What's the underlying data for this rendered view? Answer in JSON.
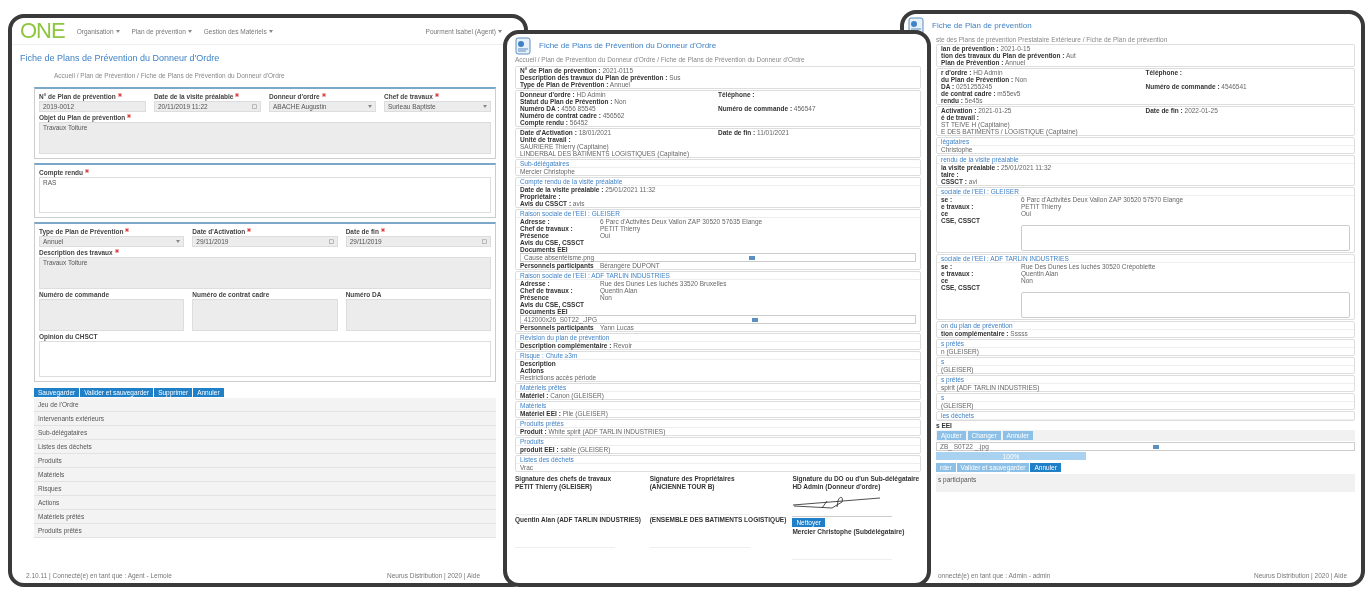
{
  "left_window": {
    "logo": "ONE",
    "nav": [
      {
        "label": "Organisation"
      },
      {
        "label": "Plan de prévention"
      },
      {
        "label": "Gestion des Matériels"
      }
    ],
    "user": "Pourment Isabel (Agent)",
    "title": "Fiche de Plans de Prévention du Donneur d'Ordre",
    "breadcrumb": "Accueil / Plan de Prévention / Fiche de Plans de Prévention du Donneur d'Ordre",
    "panels": [
      {
        "fields": [
          {
            "label": "N° de Plan de prévention",
            "required": true,
            "kind": "input",
            "value": "2019-0012"
          },
          {
            "label": "Date de la visite préalable",
            "required": true,
            "kind": "date",
            "value": "20/11/2019 11:22"
          },
          {
            "label": "Donneur d'ordre",
            "required": true,
            "kind": "select",
            "value": "ABACHE Augustin"
          },
          {
            "label": "Chef de travaux",
            "required": true,
            "kind": "select",
            "value": "Surleau Baptiste"
          },
          {
            "label": "Objet du Plan de prévention",
            "required": true,
            "kind": "textarea",
            "value": "Travaux Toiture",
            "wide": true
          }
        ]
      },
      {
        "fields": [
          {
            "label": "Compte rendu",
            "required": true,
            "kind": "note",
            "value": "RAS"
          }
        ]
      },
      {
        "fields": [
          {
            "label": "Type de Plan de Prévention",
            "required": true,
            "kind": "select",
            "value": "Annuel"
          },
          {
            "label": "Date d'Activation",
            "required": true,
            "kind": "date",
            "value": "29/11/2019"
          },
          {
            "label": "Date de fin",
            "required": true,
            "kind": "date",
            "value": "29/11/2019"
          },
          {
            "label": "Description des travaux",
            "required": true,
            "kind": "textarea",
            "value": "Travaux Toiture",
            "wide": true
          },
          {
            "label": "Numéro de commande",
            "required": false,
            "kind": "textarea"
          },
          {
            "label": "Numéro de contrat cadre",
            "required": false,
            "kind": "textarea"
          },
          {
            "label": "Numéro DA",
            "required": false,
            "kind": "textarea"
          },
          {
            "label": "Opinion du CHSCT",
            "required": false,
            "kind": "note",
            "wide": true
          }
        ]
      }
    ],
    "buttons": [
      "Sauvegarder",
      "Valider et sauvegarder",
      "Supprimer",
      "Annuler"
    ],
    "sections": [
      "Jeu de l'Ordre",
      "Intervenants extérieurs",
      "Sub-délégataires",
      "Listes des déchets",
      "Produits",
      "Matériels",
      "Risques",
      "Actions",
      "Matériels prêtés",
      "Produits prêtés"
    ],
    "footer_left": "2.10.11 | Connecté(e) en tant que : Agent - Lemoie",
    "footer_right": "Neurus Distribution | 2020 | Aide"
  },
  "middle_window": {
    "title": "Fiche de Plans de Prévention du Donneur d'Ordre",
    "breadcrumb": "Accueil / Plan de Prévention du Donneur d'Ordre / Fiche de Plans de Prévention du Donneur d'Ordre",
    "cards": [
      {
        "kind": "inline",
        "rows": [
          [
            {
              "kind": "pair",
              "label": "N° de Plan de prévention :",
              "value": "2021-0115"
            }
          ],
          [
            {
              "kind": "pair",
              "label": "Description des travaux du Plan de prévention :",
              "value": "Sus"
            }
          ],
          [
            {
              "kind": "pair",
              "label": "Type de Plan de Prévention :",
              "value": "Annuel"
            }
          ]
        ]
      },
      {
        "kind": "inline",
        "rows": [
          [
            {
              "kind": "pair",
              "label": "Donneur d'ordre :",
              "value": "HD Admin"
            },
            {
              "kind": "pair",
              "label": "Téléphone :"
            }
          ],
          [
            {
              "kind": "pair",
              "label": "Statut du Plan de Prévention :",
              "value": "Non"
            }
          ],
          [
            {
              "kind": "pair",
              "label": "Numéro DA :",
              "value": "4556 85545"
            },
            {
              "kind": "pair",
              "label": "Numéro de commande :",
              "value": "456547"
            }
          ],
          [
            {
              "kind": "pair",
              "label": "Numéro de contrat cadre :",
              "value": "456562"
            }
          ],
          [
            {
              "kind": "pair",
              "label": "Compte rendu :",
              "value": "56452"
            }
          ]
        ]
      },
      {
        "kind": "inline",
        "rows": [
          [
            {
              "kind": "pair",
              "label": "Date d'Activation :",
              "value": "18/01/2021"
            },
            {
              "kind": "pair",
              "label": "Date de fin :",
              "value": "11/01/2021"
            }
          ],
          [
            {
              "kind": "pair",
              "label": "Unité de travail :"
            }
          ],
          [
            {
              "kind": "text",
              "text": "SAURIERE Thierry (Capitaine)"
            }
          ],
          [
            {
              "kind": "text",
              "text": "LINDERBAL DES BATIMENTS LOGISTIQUES (Capitaine)"
            }
          ]
        ]
      },
      {
        "heading": "Sub-délégataires",
        "kind": "inline",
        "rows": [
          [
            {
              "kind": "text",
              "text": "Mercier Christophe"
            }
          ]
        ]
      },
      {
        "heading": "Compte rendu de la visite préalable",
        "kind": "inline",
        "rows": [
          [
            {
              "kind": "pair",
              "label": "Date de la visite préalable :",
              "value": "25/01/2021 11:32"
            }
          ],
          [
            {
              "kind": "pair",
              "label": "Propriétaire :"
            }
          ],
          [
            {
              "kind": "pair",
              "label": "Avis du CSSCT :",
              "value": "avis"
            }
          ]
        ]
      },
      {
        "heading": "Raison sociale de l'EEI : GLEISER",
        "kind": "table",
        "rows": [
          [
            {
              "kind": "pair",
              "label": "Adresse :",
              "value": "6 Parc d'Activités Deux Vallon ZAP 30520 57635 Elange"
            }
          ],
          [
            {
              "kind": "pair",
              "label": "Chef de travaux :",
              "value": "PETIT Thierry"
            }
          ],
          [
            {
              "kind": "pair",
              "label": "Présence",
              "value": "Oui"
            }
          ],
          [
            {
              "kind": "pair",
              "label": "Avis du CSE, CSSCT"
            }
          ],
          [
            {
              "kind": "pair",
              "label": "Documents EEI"
            }
          ],
          [
            {
              "kind": "file",
              "text": "Cause absentéisme.png"
            }
          ],
          [
            {
              "kind": "pair",
              "label": "Personnels participants",
              "value": "Bérangère DUPONT"
            }
          ]
        ]
      },
      {
        "heading": "Raison sociale de l'EEI : ADF TARLIN INDUSTRIES",
        "kind": "table",
        "rows": [
          [
            {
              "kind": "pair",
              "label": "Adresse :",
              "value": "Rue des Dunes Les Iuchés 33520 Bruxelles"
            }
          ],
          [
            {
              "kind": "pair",
              "label": "Chef de travaux :",
              "value": "Quentin Alan"
            }
          ],
          [
            {
              "kind": "pair",
              "label": "Présence",
              "value": "Non"
            }
          ],
          [
            {
              "kind": "pair",
              "label": "Avis du CSE, CSSCT"
            }
          ],
          [
            {
              "kind": "pair",
              "label": "Documents EEI"
            }
          ],
          [
            {
              "kind": "file",
              "text": "412000x26_S0T22_.JPG"
            }
          ],
          [
            {
              "kind": "pair",
              "label": "Personnels participants",
              "value": "Yann Lucas"
            }
          ]
        ]
      },
      {
        "heading": "Révision du plan de prévention",
        "kind": "inline",
        "rows": [
          [
            {
              "kind": "pair",
              "label": "Description complémentaire :",
              "value": "Revoir"
            }
          ]
        ]
      },
      {
        "heading": "Risque : Chute ≥3m",
        "kind": "inline",
        "rows": [
          [
            {
              "kind": "pair",
              "label": "Description"
            }
          ],
          [
            {
              "kind": "pair",
              "label": "Actions"
            }
          ],
          [
            {
              "kind": "text",
              "text": "Restrictions accès période"
            }
          ]
        ]
      },
      {
        "heading": "Matériels prêtés",
        "kind": "inline",
        "rows": [
          [
            {
              "kind": "pair",
              "label": "Matériel :",
              "value": "Canon (GLEISER)"
            }
          ]
        ]
      },
      {
        "heading": "Matériels",
        "kind": "inline",
        "rows": [
          [
            {
              "kind": "pair",
              "label": "Matériel EEI :",
              "value": "Pile (GLEISER)"
            }
          ]
        ]
      },
      {
        "heading": "Produits prêtés",
        "kind": "inline",
        "rows": [
          [
            {
              "kind": "pair",
              "label": "Produit :",
              "value": "White spirit (ADF TARLIN INDUSTRIES)"
            }
          ]
        ]
      },
      {
        "heading": "Produits",
        "kind": "inline",
        "rows": [
          [
            {
              "kind": "pair",
              "label": "produit EEI :",
              "value": "sable (GLEISER)"
            }
          ]
        ]
      },
      {
        "heading": "Listes des déchets",
        "kind": "inline",
        "rows": [
          [
            {
              "kind": "text",
              "text": "Vrac"
            }
          ]
        ]
      }
    ],
    "signatures": [
      {
        "heading": "Signature des chefs de travaux",
        "people": [
          {
            "name": "PETIT Thierry (GLEISER)",
            "signed": false
          },
          {
            "name": "Quentin Alan (ADF TARLIN INDUSTRIES)",
            "signed": false
          }
        ]
      },
      {
        "heading": "Signature des Propriétaires",
        "people": [
          {
            "name": "(ANCIENNE TOUR B)",
            "signed": false
          },
          {
            "name": "(ENSEMBLE DES BATIMENTS LOGISTIQUE)",
            "signed": false
          }
        ]
      },
      {
        "heading": "Signature du DO ou d'un Sub-délégataire",
        "people": [
          {
            "name": "HD Admin (Donneur d'ordre)",
            "signed": true,
            "button": "Nettoyer"
          },
          {
            "name": "Mercier Christophe (Subdélégataire)",
            "signed": false
          }
        ]
      }
    ]
  },
  "right_window": {
    "title": "Fiche de Plan de prévention",
    "breadcrumb": "ste des Plans de prévention Prestataire Extérieure / Fiche de Plan de prévention",
    "cards": [
      {
        "kind": "inline",
        "rows": [
          [
            {
              "kind": "pair",
              "label": "lan de prévention :",
              "value": "2021-0-15"
            }
          ],
          [
            {
              "kind": "pair",
              "label": "tion des travaux du Plan de prévention :",
              "value": "Aut"
            }
          ],
          [
            {
              "kind": "pair",
              "label": "Plan de Prévention :",
              "value": "Annuel"
            }
          ]
        ]
      },
      {
        "kind": "inline",
        "rows": [
          [
            {
              "kind": "pair",
              "label": "r d'ordre :",
              "value": "HD Admin"
            },
            {
              "kind": "pair",
              "label": "Téléphone :"
            }
          ],
          [
            {
              "kind": "pair",
              "label": "du Plan de Prévention :",
              "value": "Non"
            }
          ],
          [
            {
              "kind": "pair",
              "label": "DA :",
              "value": "0251255245"
            },
            {
              "kind": "pair",
              "label": "Numéro de commande :",
              "value": "4546541"
            }
          ],
          [
            {
              "kind": "pair",
              "label": "de contrat cadre :",
              "value": "m55ev5"
            }
          ],
          [
            {
              "kind": "pair",
              "label": "rendu :",
              "value": "5e45s"
            }
          ]
        ]
      },
      {
        "kind": "inline",
        "rows": [
          [
            {
              "kind": "pair",
              "label": "Activation :",
              "value": "2021-01-25"
            },
            {
              "kind": "pair",
              "label": "Date de fin :",
              "value": "2022-01-25"
            }
          ],
          [
            {
              "kind": "pair",
              "label": "é de travail :"
            }
          ],
          [
            {
              "kind": "text",
              "text": "ST TEIVE H (Capitaine)"
            }
          ],
          [
            {
              "kind": "text",
              "text": "E DES BATIMENTS / LOGISTIQUE (Capitaine)"
            }
          ]
        ]
      },
      {
        "heading": "légataires",
        "kind": "inline",
        "rows": [
          [
            {
              "kind": "text",
              "text": "Christophe"
            }
          ]
        ]
      },
      {
        "heading": "rendu de la visite préalable",
        "kind": "inline",
        "rows": [
          [
            {
              "kind": "pair",
              "label": "la visite préalable :",
              "value": "25/01/2021 11:32"
            }
          ],
          [
            {
              "kind": "pair",
              "label": "taire :"
            }
          ],
          [
            {
              "kind": "pair",
              "label": "CSSCT :",
              "value": "avi"
            }
          ]
        ]
      },
      {
        "heading": "sociale de l'EEI : GLEISER",
        "kind": "table",
        "rows": [
          [
            {
              "kind": "pair",
              "label": "se :",
              "value": "6 Parc d'Activités Deux Vallon ZAP 30520 57570 Elange"
            }
          ],
          [
            {
              "kind": "pair",
              "label": "e travaux :",
              "value": "PETIT Thierry"
            }
          ],
          [
            {
              "kind": "pair",
              "label": "ce",
              "value": "Oui"
            }
          ],
          [
            {
              "kind": "pair",
              "label": "CSE, CSSCT"
            }
          ],
          [
            {
              "kind": "area"
            }
          ]
        ]
      },
      {
        "heading": "sociale de l'EEI : ADF TARLIN INDUSTRIES",
        "kind": "table",
        "rows": [
          [
            {
              "kind": "pair",
              "label": "se :",
              "value": "Rue Des Dunes Les Iuchés 30520 Crépoblette"
            }
          ],
          [
            {
              "kind": "pair",
              "label": "e travaux :",
              "value": "Quentin Alan"
            }
          ],
          [
            {
              "kind": "pair",
              "label": "ce",
              "value": "Non"
            }
          ],
          [
            {
              "kind": "pair",
              "label": "CSE, CSSCT"
            }
          ],
          [
            {
              "kind": "area"
            }
          ]
        ]
      },
      {
        "heading": "on du plan de prévention",
        "kind": "inline",
        "rows": [
          [
            {
              "kind": "pair",
              "label": "tion complémentaire :",
              "value": "Sssss"
            }
          ]
        ]
      },
      {
        "heading": "s prêtés",
        "kind": "inline",
        "rows": [
          [
            {
              "kind": "text",
              "text": "n (GLEISER)"
            }
          ]
        ]
      },
      {
        "heading": "s",
        "kind": "inline",
        "rows": [
          [
            {
              "kind": "text",
              "text": "(GLEISER)"
            }
          ]
        ]
      },
      {
        "heading": "s prêtés",
        "kind": "inline",
        "rows": [
          [
            {
              "kind": "text",
              "text": "spirit (ADF TARLIN INDUSTRIES)"
            }
          ]
        ]
      },
      {
        "heading": "s",
        "kind": "inline",
        "rows": [
          [
            {
              "kind": "text",
              "text": "(GLEISER)"
            }
          ]
        ]
      },
      {
        "heading": "les déchets"
      }
    ],
    "documents_label": "s EEI",
    "tool_buttons": [
      "Ajouter",
      "Changer",
      "Annuler"
    ],
    "file": "ZB_ S0T22 _.jpg",
    "progress": {
      "level": 1,
      "text": "100%"
    },
    "buttons": [
      {
        "label": "rder",
        "primary": false
      },
      {
        "label": "Valider et sauvegarder",
        "primary": false
      },
      {
        "label": "Annuler",
        "primary": true
      }
    ],
    "participants": "s participants",
    "footer_left": "onnecté(e) en tant que : Admin - admin",
    "footer_right": "Neurus Distribution | 2020 | Aide"
  }
}
